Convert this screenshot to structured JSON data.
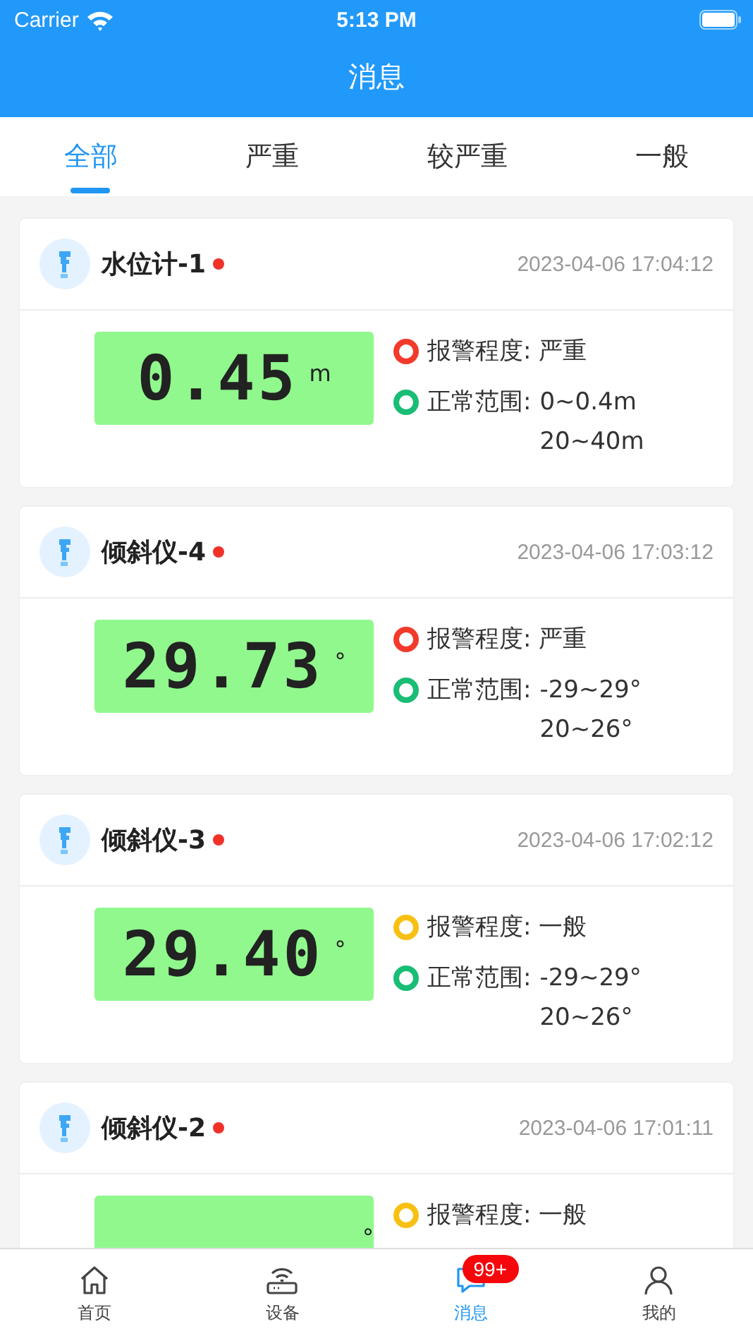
{
  "status_bar": {
    "carrier": "Carrier",
    "time": "5:13 PM"
  },
  "header": {
    "title": "消息"
  },
  "tabs": [
    {
      "label": "全部",
      "selected": true
    },
    {
      "label": "严重",
      "selected": false
    },
    {
      "label": "较严重",
      "selected": false
    },
    {
      "label": "一般",
      "selected": false
    }
  ],
  "alerts": [
    {
      "name": "水位计-1",
      "unread": true,
      "time": "2023-04-06 17:04:12",
      "value": "0.45",
      "unit": "m",
      "alarm": {
        "label": "报警程度:",
        "value": "严重",
        "color": "#f23a2c"
      },
      "range": {
        "label": "正常范围:",
        "lines": [
          "0~0.4m",
          "20~40m"
        ],
        "color": "#19bd75"
      }
    },
    {
      "name": "倾斜仪-4",
      "unread": true,
      "time": "2023-04-06 17:03:12",
      "value": "29.73",
      "unit": "°",
      "alarm": {
        "label": "报警程度:",
        "value": "严重",
        "color": "#f23a2c"
      },
      "range": {
        "label": "正常范围:",
        "lines": [
          "-29~29°",
          "20~26°"
        ],
        "color": "#19bd75"
      }
    },
    {
      "name": "倾斜仪-3",
      "unread": true,
      "time": "2023-04-06 17:02:12",
      "value": "29.40",
      "unit": "°",
      "alarm": {
        "label": "报警程度:",
        "value": "一般",
        "color": "#f8c012"
      },
      "range": {
        "label": "正常范围:",
        "lines": [
          "-29~29°",
          "20~26°"
        ],
        "color": "#19bd75"
      }
    },
    {
      "name": "倾斜仪-2",
      "unread": true,
      "time": "2023-04-06 17:01:11",
      "unit": "°",
      "alarm": {
        "label": "报警程度:",
        "value": "一般",
        "color": "#f8c012"
      }
    }
  ],
  "tab_bar": [
    {
      "label": "首页",
      "kind": "home",
      "selected": false
    },
    {
      "label": "设备",
      "kind": "router",
      "selected": false
    },
    {
      "label": "消息",
      "kind": "chat",
      "selected": true,
      "badge": "99+"
    },
    {
      "label": "我的",
      "kind": "person",
      "selected": false
    }
  ]
}
